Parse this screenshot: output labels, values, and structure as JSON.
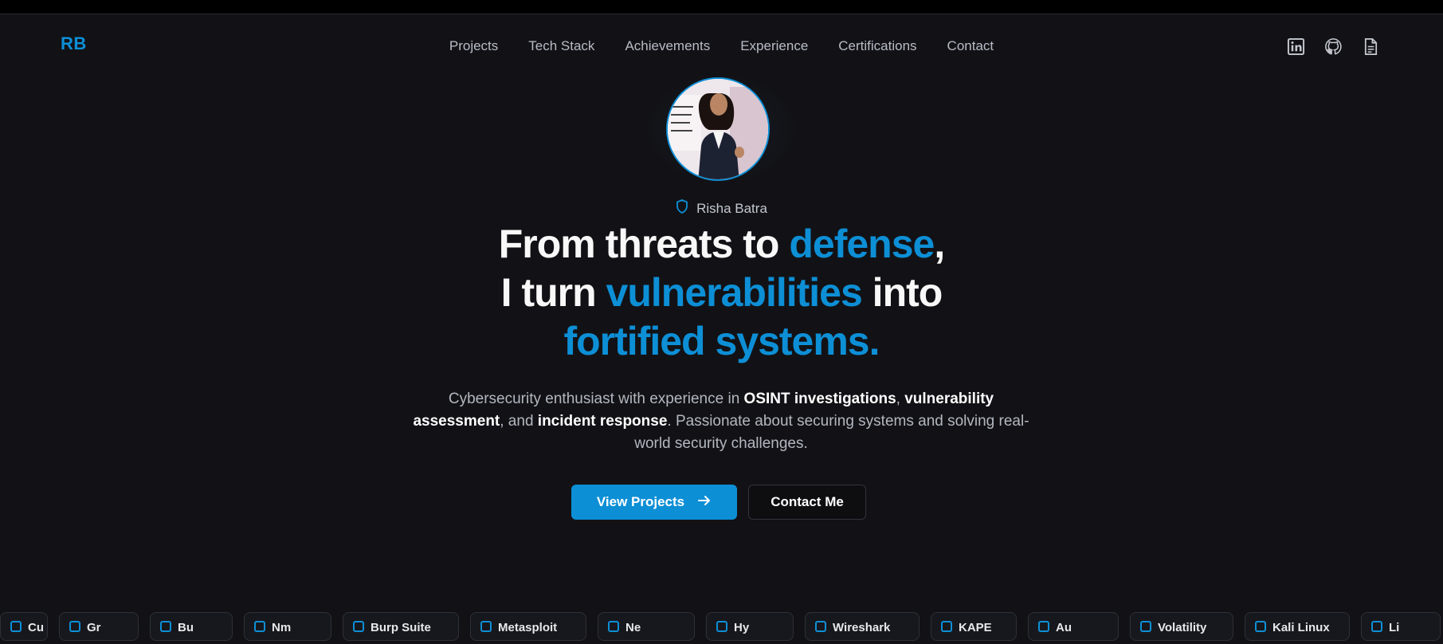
{
  "brand": {
    "logo_text": "RB",
    "accent_color": "#0d8fd6"
  },
  "nav": {
    "links": [
      {
        "label": "Projects"
      },
      {
        "label": "Tech Stack"
      },
      {
        "label": "Achievements"
      },
      {
        "label": "Experience"
      },
      {
        "label": "Certifications"
      },
      {
        "label": "Contact"
      }
    ],
    "icons": [
      "linkedin-icon",
      "github-icon",
      "resume-document-icon"
    ]
  },
  "hero": {
    "name": "Risha Batra",
    "name_icon": "shield-icon",
    "headline": {
      "line1_a": "From threats to ",
      "line1_accent": "defense",
      "line1_b": ",",
      "line2_a": "I turn ",
      "line2_accent": "vulnerabilities",
      "line2_b": " into",
      "line3_accent": "fortified systems."
    },
    "subtitle": {
      "p1": "Cybersecurity enthusiast with experience in ",
      "b1": "OSINT investigations",
      "p2": ", ",
      "b2": "vulnerability assessment",
      "p3": ", and ",
      "b3": "incident response",
      "p4": ". Passionate about securing systems and solving real-world security challenges."
    },
    "primary_button": "View Projects",
    "secondary_button": "Contact Me"
  },
  "ticker": {
    "chips": [
      "Cu",
      "Gr",
      "Bu",
      "Nm",
      "Burp Suite",
      "Metasploit",
      "Ne",
      "Hy",
      "Wireshark",
      "KAPE",
      "Au",
      "Volatility",
      "Kali Linux",
      "Li"
    ]
  }
}
